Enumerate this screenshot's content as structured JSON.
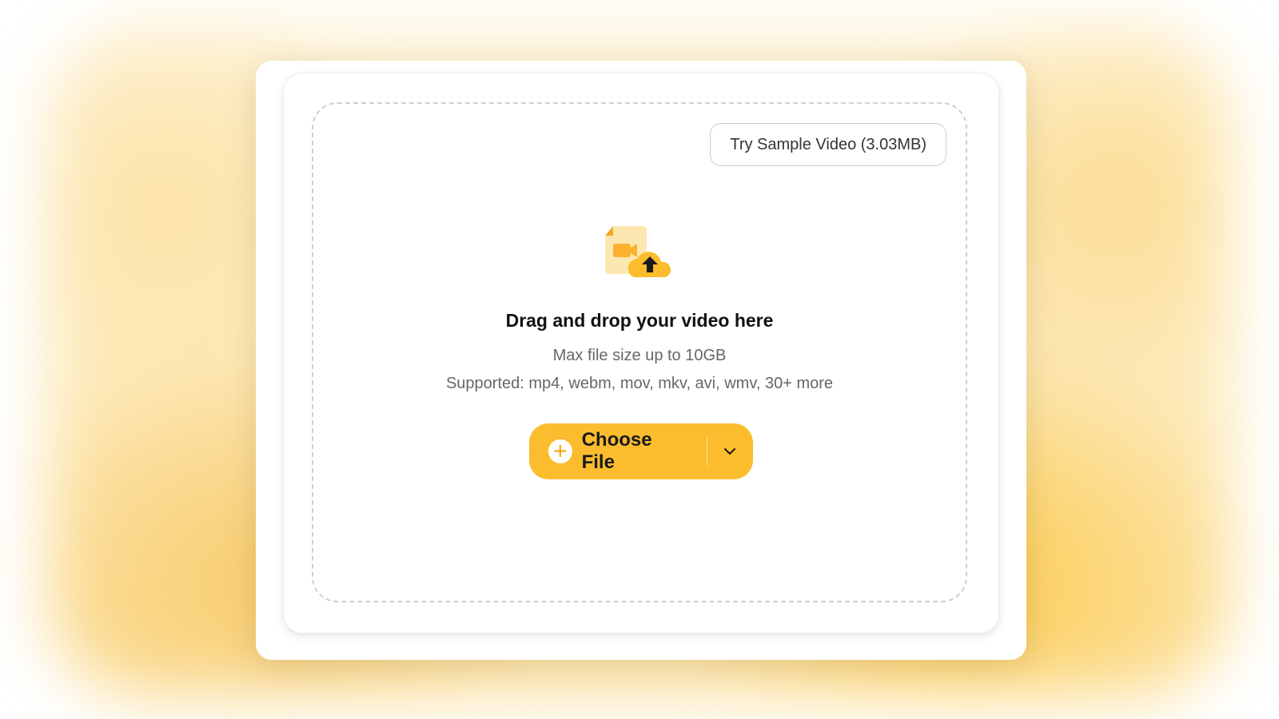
{
  "dropzone": {
    "sample_button_label": "Try Sample Video (3.03MB)",
    "icon": "video-upload-icon",
    "title": "Drag and drop your video here",
    "max_size_text": "Max file size up to 10GB",
    "supported_text": "Supported: mp4, webm, mov, mkv, avi, wmv, 30+ more"
  },
  "upload_button": {
    "label": "Choose File",
    "plus_symbol": "+",
    "icon": "plus-circle-icon",
    "dropdown_icon": "chevron-down-icon"
  },
  "colors": {
    "accent": "#fbbd2e",
    "background_glow": "#fcd36a",
    "text_primary": "#111111",
    "text_secondary": "#666666",
    "dashed_border": "#cfcfcf"
  }
}
